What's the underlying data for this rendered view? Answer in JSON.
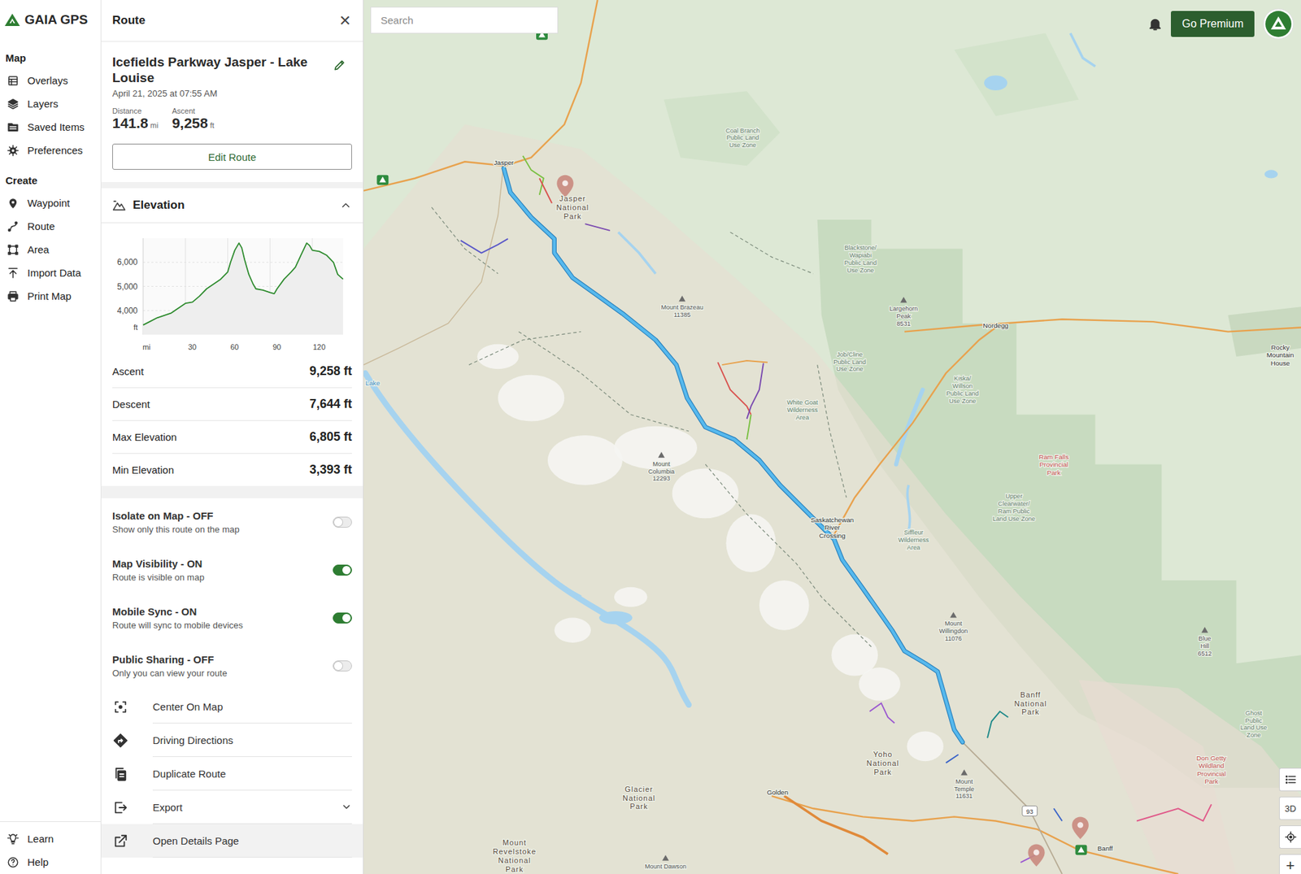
{
  "app": {
    "logo": "GAIA GPS"
  },
  "nav": {
    "sections": [
      {
        "title": "Map",
        "items": [
          "Overlays",
          "Layers",
          "Saved Items",
          "Preferences"
        ]
      },
      {
        "title": "Create",
        "items": [
          "Waypoint",
          "Route",
          "Area",
          "Import Data",
          "Print Map"
        ]
      }
    ],
    "footer": [
      "Learn",
      "Help"
    ]
  },
  "panel": {
    "header": "Route",
    "close": "×",
    "title": "Icefields Parkway Jasper - Lake Louise",
    "date": "April 21, 2025 at 07:55 AM",
    "stats": [
      {
        "label": "Distance",
        "value": "141.8",
        "unit": "mi"
      },
      {
        "label": "Ascent",
        "value": "9,258",
        "unit": "ft"
      }
    ],
    "edit_button": "Edit Route",
    "elevation": {
      "title": "Elevation",
      "expanded": true,
      "chart": {
        "y_ticks": [
          "6,000",
          "5,000",
          "4,000"
        ],
        "y_unit": "ft",
        "x_ticks": [
          "mi",
          "30",
          "60",
          "90",
          "120"
        ],
        "distances": [
          0,
          5,
          10,
          15,
          20,
          25,
          30,
          35,
          40,
          45,
          50,
          55,
          60,
          62,
          65,
          68,
          70,
          72,
          75,
          78,
          80,
          85,
          90,
          93,
          95,
          100,
          105,
          108,
          112,
          116,
          118,
          120,
          125,
          130,
          135,
          138,
          141.8
        ],
        "elevations": [
          3400,
          3550,
          3700,
          3800,
          3900,
          4100,
          4300,
          4350,
          4600,
          4900,
          5100,
          5300,
          5600,
          6000,
          6500,
          6800,
          6600,
          6100,
          5500,
          5100,
          4900,
          4850,
          4750,
          4700,
          4900,
          5300,
          5600,
          5800,
          6300,
          6800,
          6700,
          6500,
          6450,
          6300,
          6000,
          5500,
          5300
        ]
      }
    },
    "summary": [
      {
        "label": "Ascent",
        "value": "9,258 ft"
      },
      {
        "label": "Descent",
        "value": "7,644 ft"
      },
      {
        "label": "Max Elevation",
        "value": "6,805 ft"
      },
      {
        "label": "Min Elevation",
        "value": "3,393 ft"
      }
    ],
    "toggles": [
      {
        "title": "Isolate on Map - OFF",
        "desc": "Show only this route on the map",
        "on": false
      },
      {
        "title": "Map Visibility - ON",
        "desc": "Route is visible on map",
        "on": true
      },
      {
        "title": "Mobile Sync - ON",
        "desc": "Route will sync to mobile devices",
        "on": true
      },
      {
        "title": "Public Sharing - OFF",
        "desc": "Only you can view your route",
        "on": false
      }
    ],
    "actions": [
      {
        "label": "Center On Map",
        "expandable": false,
        "highlighted": false
      },
      {
        "label": "Driving Directions",
        "expandable": false,
        "highlighted": false
      },
      {
        "label": "Duplicate Route",
        "expandable": false,
        "highlighted": false
      },
      {
        "label": "Export",
        "expandable": true,
        "highlighted": false
      },
      {
        "label": "Open Details Page",
        "expandable": false,
        "highlighted": true
      }
    ]
  },
  "map": {
    "search": {
      "placeholder": "Search"
    },
    "premium_button": "Go Premium",
    "view_3d": "3D",
    "zoom_in": "+",
    "road_shields": [
      "93"
    ],
    "labels": [
      {
        "lines": [
          "Jasper"
        ],
        "kind": "place"
      },
      {
        "lines": [
          "Jasper",
          "National",
          "Park"
        ],
        "kind": "park"
      },
      {
        "lines": [
          "Mount Brazeau",
          "11385"
        ],
        "kind": "peak"
      },
      {
        "lines": [
          "Coal Branch",
          "Public Land",
          "Use Zone"
        ],
        "kind": "zone"
      },
      {
        "lines": [
          "Blackstone/",
          "Wapiabi",
          "Public Land",
          "Use Zone"
        ],
        "kind": "zone"
      },
      {
        "lines": [
          "Largehorn",
          "Peak",
          "8531"
        ],
        "kind": "peak"
      },
      {
        "lines": [
          "Nordegg"
        ],
        "kind": "place"
      },
      {
        "lines": [
          "Rocky",
          "Mountain",
          "House"
        ],
        "kind": "place"
      },
      {
        "lines": [
          "Job/Cline",
          "Public Land",
          "Use Zone"
        ],
        "kind": "zone"
      },
      {
        "lines": [
          "White Goat",
          "Wilderness",
          "Area"
        ],
        "kind": "zone"
      },
      {
        "lines": [
          "Kiska/",
          "Willson",
          "Public Land",
          "Use Zone"
        ],
        "kind": "zone"
      },
      {
        "lines": [
          "Ram Falls",
          "Provincial",
          "Park"
        ],
        "kind": "provincial"
      },
      {
        "lines": [
          "Mount",
          "Columbia",
          "12293"
        ],
        "kind": "peak"
      },
      {
        "lines": [
          "Saskatchewan",
          "River",
          "Crossing"
        ],
        "kind": "place"
      },
      {
        "lines": [
          "Siffleur",
          "Wilderness",
          "Area"
        ],
        "kind": "zone"
      },
      {
        "lines": [
          "Upper",
          "Clearwater/",
          "Ram Public",
          "Land Use Zone"
        ],
        "kind": "zone"
      },
      {
        "lines": [
          "Mount",
          "Willingdon",
          "11076"
        ],
        "kind": "peak"
      },
      {
        "lines": [
          "Blue",
          "Hill",
          "6512"
        ],
        "kind": "peak"
      },
      {
        "lines": [
          "Banff",
          "National",
          "Park"
        ],
        "kind": "park"
      },
      {
        "lines": [
          "Ghost",
          "Public",
          "Land Use",
          "Zone"
        ],
        "kind": "zone"
      },
      {
        "lines": [
          "Don Getty",
          "Wildland",
          "Provincial",
          "Park"
        ],
        "kind": "provincial"
      },
      {
        "lines": [
          "Yoho",
          "National",
          "Park"
        ],
        "kind": "park"
      },
      {
        "lines": [
          "Mount",
          "Temple",
          "11631"
        ],
        "kind": "peak"
      },
      {
        "lines": [
          "Golden"
        ],
        "kind": "place"
      },
      {
        "lines": [
          "Glacier",
          "National",
          "Park"
        ],
        "kind": "park"
      },
      {
        "lines": [
          "Mount",
          "Revelstoke",
          "National",
          "Park"
        ],
        "kind": "park"
      },
      {
        "lines": [
          "Mount Dawson"
        ],
        "kind": "peak"
      },
      {
        "lines": [
          "Banff"
        ],
        "kind": "place"
      },
      {
        "lines": [
          "Lake"
        ],
        "kind": "water"
      }
    ]
  }
}
